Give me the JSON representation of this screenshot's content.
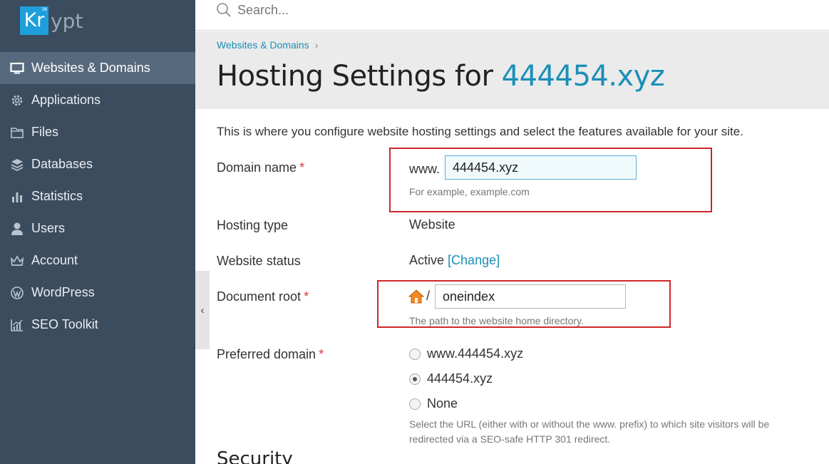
{
  "brand": {
    "logo_box_text": "Kr",
    "logo_superscript": "38",
    "logo_rest_text": "ypt",
    "accent_color": "#1e9fdc",
    "sidebar_color": "#3b4c5e",
    "link_color": "#1b8fb8",
    "highlight_color": "#d1262b"
  },
  "search": {
    "placeholder": "Search..."
  },
  "sidebar": {
    "items": [
      {
        "label": "Websites & Domains",
        "icon": "monitor-icon",
        "active": true
      },
      {
        "label": "Applications",
        "icon": "gear-icon",
        "active": false
      },
      {
        "label": "Files",
        "icon": "folder-icon",
        "active": false
      },
      {
        "label": "Databases",
        "icon": "database-icon",
        "active": false
      },
      {
        "label": "Statistics",
        "icon": "bar-chart-icon",
        "active": false
      },
      {
        "label": "Users",
        "icon": "user-icon",
        "active": false
      },
      {
        "label": "Account",
        "icon": "account-icon",
        "active": false
      },
      {
        "label": "WordPress",
        "icon": "wordpress-icon",
        "active": false
      },
      {
        "label": "SEO Toolkit",
        "icon": "seo-chart-icon",
        "active": false
      }
    ],
    "collapse_glyph": "‹"
  },
  "header": {
    "breadcrumb": "Websites & Domains",
    "breadcrumb_sep": "›",
    "title_prefix": "Hosting Settings for ",
    "title_domain": "444454.xyz"
  },
  "form": {
    "intro": "This is where you configure website hosting settings and select the features available for your site.",
    "domain_name": {
      "label": "Domain name",
      "required": "*",
      "prefix": "www.",
      "value": "444454.xyz",
      "hint": "For example, example.com"
    },
    "hosting_type": {
      "label": "Hosting type",
      "value": "Website"
    },
    "website_status": {
      "label": "Website status",
      "value": "Active",
      "change_link": "[Change]"
    },
    "document_root": {
      "label": "Document root",
      "required": "*",
      "separator": "/",
      "value": "oneindex",
      "hint": "The path to the website home directory."
    },
    "preferred_domain": {
      "label": "Preferred domain",
      "required": "*",
      "options": [
        {
          "label": "www.444454.xyz",
          "checked": false
        },
        {
          "label": "444454.xyz",
          "checked": true
        },
        {
          "label": "None",
          "checked": false
        }
      ],
      "hint_line1": "Select the URL (either with or without the www. prefix) to which site visitors will be",
      "hint_line2": "redirected via a SEO-safe HTTP 301 redirect."
    },
    "security_title": "Security"
  }
}
